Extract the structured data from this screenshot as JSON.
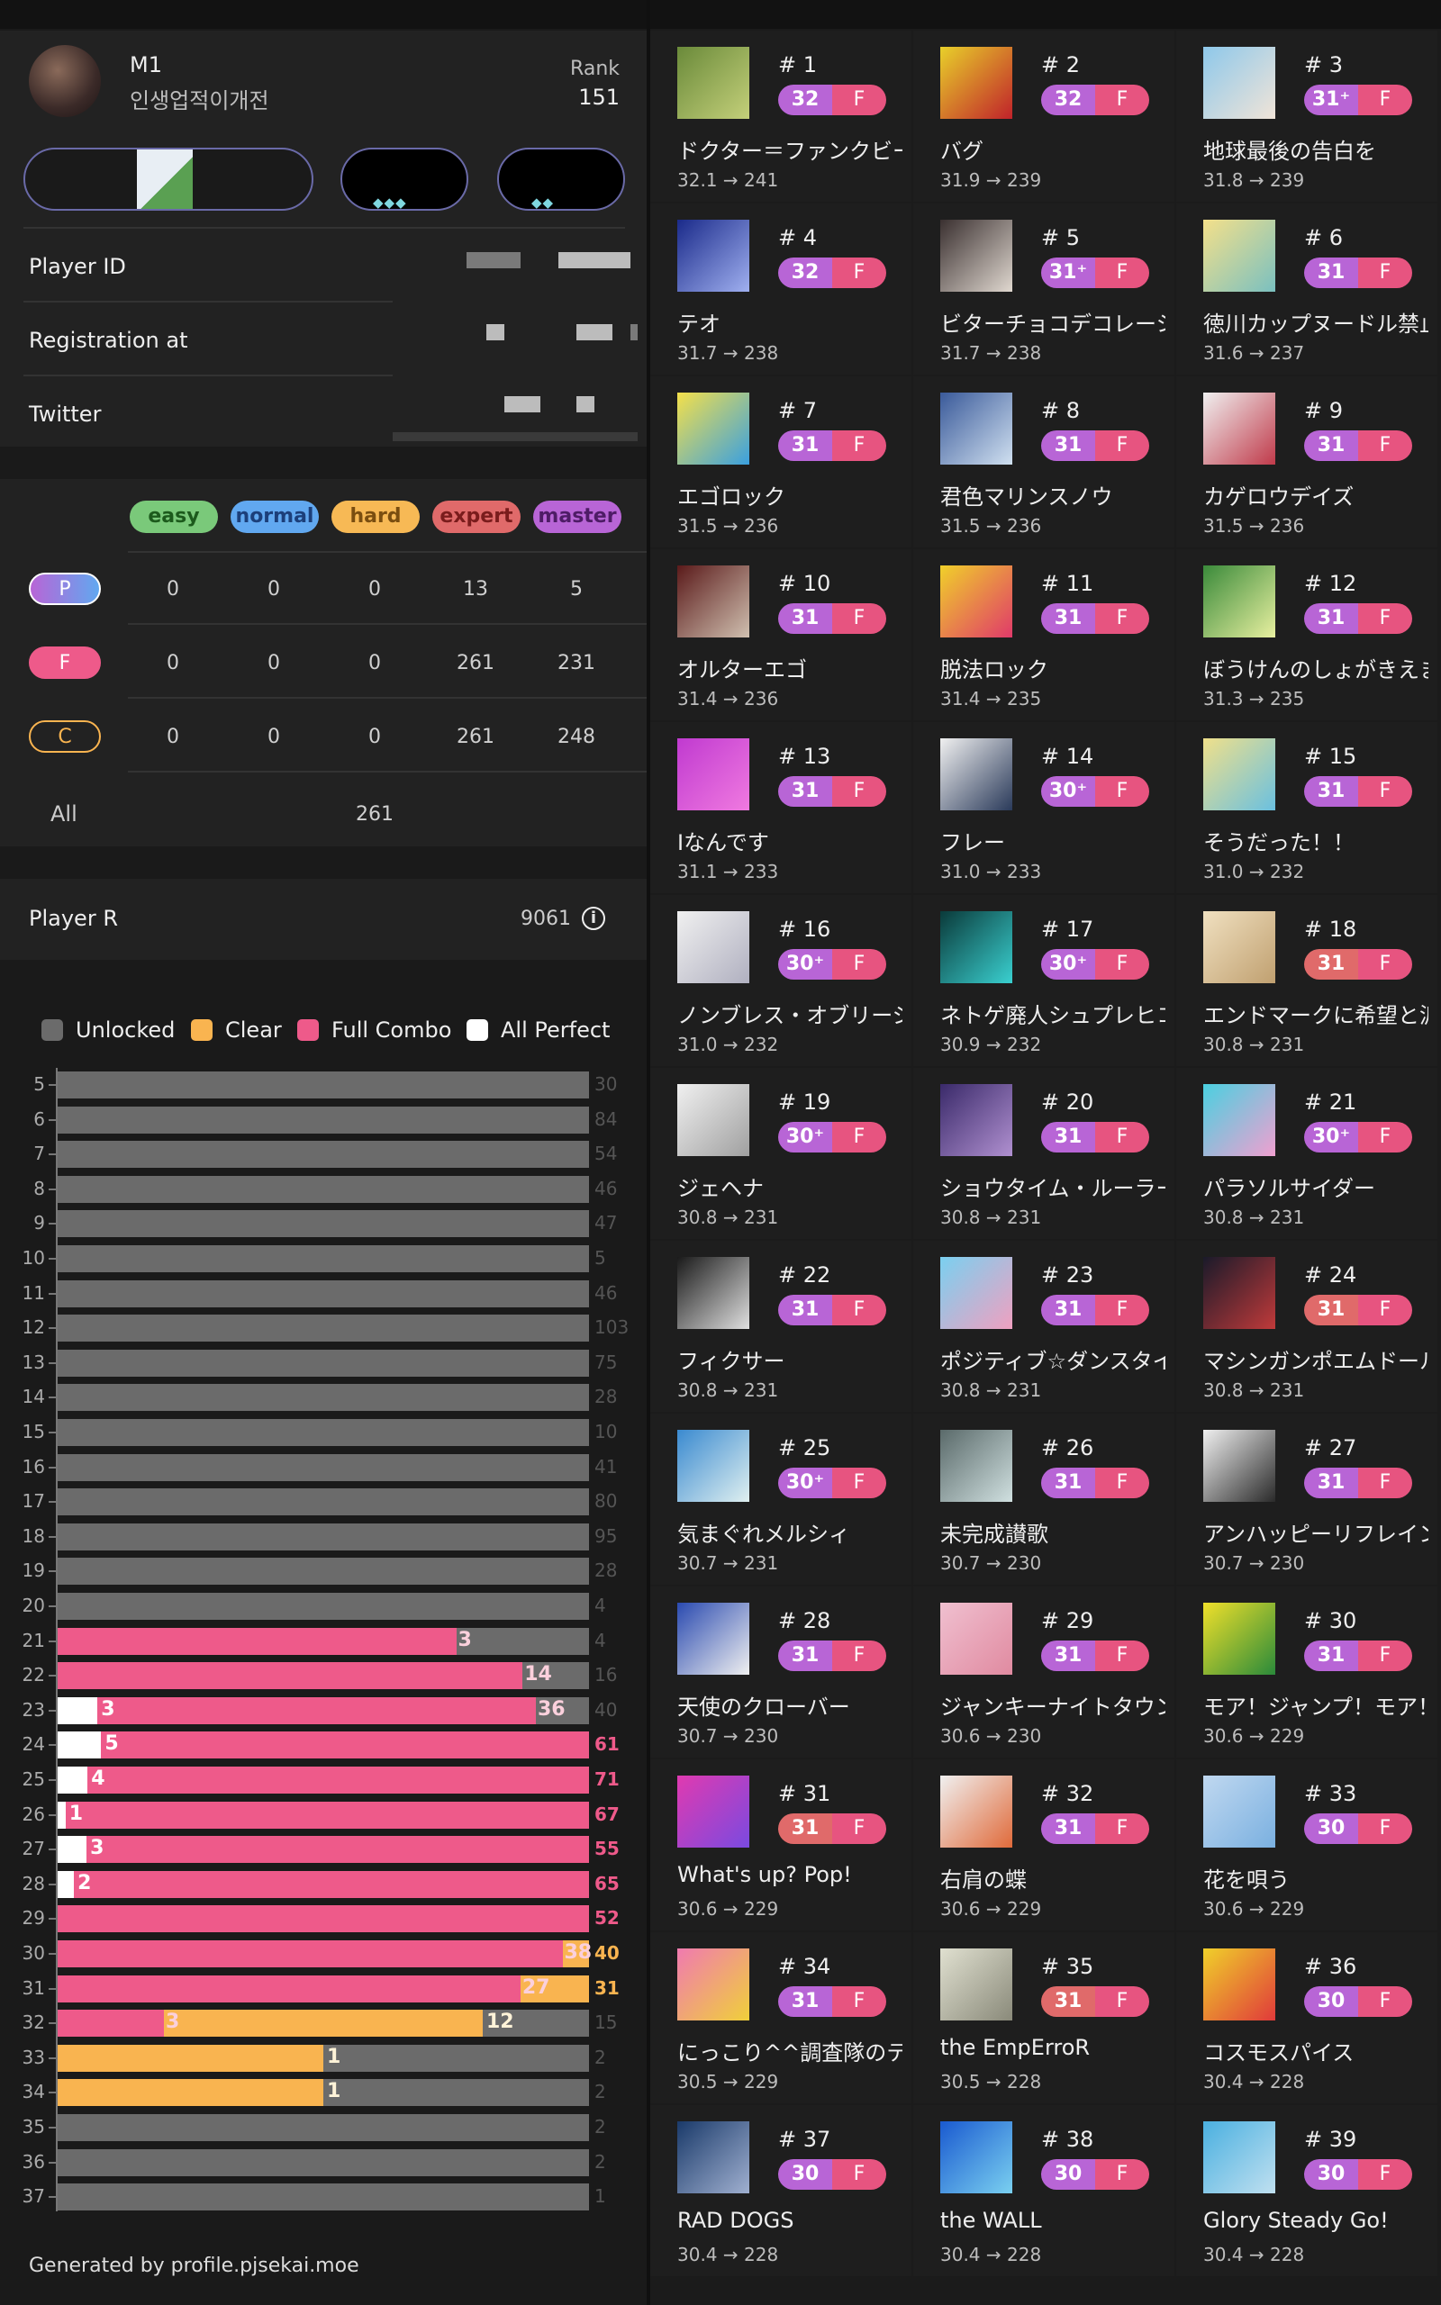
{
  "profile": {
    "name": "M1",
    "word": "인생업적이개전",
    "rank_label": "Rank",
    "rank": "151"
  },
  "info": {
    "player_id_label": "Player ID",
    "registration_label": "Registration at",
    "twitter_label": "Twitter"
  },
  "difficulties": [
    {
      "label": "easy",
      "color": "#7ac97a",
      "text": "#1c5a1c"
    },
    {
      "label": "normal",
      "color": "#61a8f0",
      "text": "#1c3f7a"
    },
    {
      "label": "hard",
      "color": "#f7b955",
      "text": "#7a4e10"
    },
    {
      "label": "expert",
      "color": "#e06a6a",
      "text": "#7a1c1c"
    },
    {
      "label": "master",
      "color": "#b865d6",
      "text": "#4e1c66"
    }
  ],
  "clear_table": {
    "rows": [
      {
        "badge": "P",
        "values": [
          "0",
          "0",
          "0",
          "13",
          "5"
        ]
      },
      {
        "badge": "F",
        "values": [
          "0",
          "0",
          "0",
          "261",
          "231"
        ]
      },
      {
        "badge": "C",
        "values": [
          "0",
          "0",
          "0",
          "261",
          "248"
        ]
      }
    ],
    "all_label": "All",
    "all_value": "261"
  },
  "player_r": {
    "label": "Player R",
    "value": "9061",
    "info_icon": "info-icon"
  },
  "legend": [
    "Unlocked",
    "Clear",
    "Full Combo",
    "All Perfect"
  ],
  "legend_colors": {
    "unlocked": "#6b6b6b",
    "clear": "#f9b450",
    "fullcombo": "#ee5a8a",
    "allperfect": "#ffffff"
  },
  "chart_data": {
    "type": "bar",
    "orientation": "horizontal-stacked",
    "levels": [
      5,
      6,
      7,
      8,
      9,
      10,
      11,
      12,
      13,
      14,
      15,
      16,
      17,
      18,
      19,
      20,
      21,
      22,
      23,
      24,
      25,
      26,
      27,
      28,
      29,
      30,
      31,
      32,
      33,
      34,
      35,
      36,
      37
    ],
    "totals": [
      30,
      84,
      54,
      46,
      47,
      5,
      46,
      103,
      75,
      28,
      10,
      41,
      80,
      95,
      28,
      4,
      4,
      16,
      40,
      61,
      71,
      67,
      55,
      65,
      52,
      40,
      31,
      15,
      2,
      2,
      2,
      2,
      1
    ],
    "series": [
      {
        "name": "All Perfect",
        "values": [
          0,
          0,
          0,
          0,
          0,
          0,
          0,
          0,
          0,
          0,
          0,
          0,
          0,
          0,
          0,
          0,
          0,
          0,
          3,
          5,
          4,
          1,
          3,
          2,
          0,
          0,
          0,
          0,
          0,
          0,
          0,
          0,
          0
        ]
      },
      {
        "name": "Full Combo",
        "values": [
          0,
          0,
          0,
          0,
          0,
          0,
          0,
          0,
          0,
          0,
          0,
          0,
          0,
          0,
          0,
          0,
          3,
          14,
          36,
          61,
          71,
          67,
          55,
          65,
          52,
          38,
          27,
          3,
          0,
          0,
          0,
          0,
          0
        ]
      },
      {
        "name": "Clear",
        "values": [
          0,
          0,
          0,
          0,
          0,
          0,
          0,
          0,
          0,
          0,
          0,
          0,
          0,
          0,
          0,
          0,
          3,
          14,
          36,
          61,
          71,
          67,
          55,
          65,
          52,
          40,
          31,
          12,
          1,
          1,
          0,
          0,
          0
        ]
      }
    ]
  },
  "footer": "Generated by profile.pjsekai.moe",
  "songs": [
    {
      "rank": "# 1",
      "lvl": "32",
      "title": "ドクター＝ファンクビート",
      "score": "32.1 → 241",
      "color": "#b865d6",
      "img": [
        "#6a8a3a",
        "#c4d07a"
      ]
    },
    {
      "rank": "# 2",
      "lvl": "32",
      "title": "バグ",
      "score": "31.9 → 239",
      "color": "#b865d6",
      "img": [
        "#e8d02a",
        "#c0222a"
      ]
    },
    {
      "rank": "# 3",
      "lvl": "31⁺",
      "title": "地球最後の告白を",
      "score": "31.8 → 239",
      "color": "#b865d6",
      "img": [
        "#8ec8ea",
        "#f0e4d8"
      ]
    },
    {
      "rank": "# 4",
      "lvl": "32",
      "title": "テオ",
      "score": "31.7 → 238",
      "color": "#b865d6",
      "img": [
        "#1a2a8a",
        "#a0b0f0"
      ]
    },
    {
      "rank": "# 5",
      "lvl": "31⁺",
      "title": "ビターチョコデコレーション",
      "score": "31.7 → 238",
      "color": "#b865d6",
      "img": [
        "#3a3030",
        "#e0d8d0"
      ]
    },
    {
      "rank": "# 6",
      "lvl": "31",
      "title": "徳川カップヌードル禁止令",
      "score": "31.6 → 237",
      "color": "#b865d6",
      "img": [
        "#f4e08a",
        "#7ac0c0"
      ]
    },
    {
      "rank": "# 7",
      "lvl": "31",
      "title": "エゴロック",
      "score": "31.5 → 236",
      "color": "#b865d6",
      "img": [
        "#f4e04a",
        "#3aa0e0"
      ]
    },
    {
      "rank": "# 8",
      "lvl": "31",
      "title": "君色マリンスノウ",
      "score": "31.5 → 236",
      "color": "#b865d6",
      "img": [
        "#3a5a9a",
        "#d0e0f0"
      ]
    },
    {
      "rank": "# 9",
      "lvl": "31",
      "title": "カゲロウデイズ",
      "score": "31.5 → 236",
      "color": "#b865d6",
      "img": [
        "#f0f0f0",
        "#c03a4a"
      ]
    },
    {
      "rank": "# 10",
      "lvl": "31",
      "title": "オルターエゴ",
      "score": "31.4 → 236",
      "color": "#b865d6",
      "img": [
        "#5a1a1a",
        "#d0c0b0"
      ]
    },
    {
      "rank": "# 11",
      "lvl": "31",
      "title": "脱法ロック",
      "score": "31.4 → 235",
      "color": "#b865d6",
      "img": [
        "#f0d02a",
        "#e03a6a"
      ]
    },
    {
      "rank": "# 12",
      "lvl": "31",
      "title": "ぼうけんのしょがきえました！",
      "score": "31.3 → 235",
      "color": "#b865d6",
      "img": [
        "#3a8a3a",
        "#e8f0a0"
      ]
    },
    {
      "rank": "# 13",
      "lvl": "31",
      "title": "Iなんです",
      "score": "31.1 → 233",
      "color": "#b865d6",
      "img": [
        "#c03ad0",
        "#f07ae0"
      ]
    },
    {
      "rank": "# 14",
      "lvl": "30⁺",
      "title": "フレー",
      "score": "31.0 → 233",
      "color": "#b865d6",
      "img": [
        "#f0f0f0",
        "#2a3a5a"
      ]
    },
    {
      "rank": "# 15",
      "lvl": "31",
      "title": "そうだった！！",
      "score": "31.0 → 232",
      "color": "#b865d6",
      "img": [
        "#f0e08a",
        "#6ac0e0"
      ]
    },
    {
      "rank": "# 16",
      "lvl": "30⁺",
      "title": "ノンブレス・オブリージュ",
      "score": "31.0 → 232",
      "color": "#b865d6",
      "img": [
        "#f0f0f0",
        "#b0b0c0"
      ]
    },
    {
      "rank": "# 17",
      "lvl": "30⁺",
      "title": "ネトゲ廃人シュプレヒコール",
      "score": "30.9 → 232",
      "color": "#b865d6",
      "img": [
        "#0a3a3a",
        "#3ad0d0"
      ]
    },
    {
      "rank": "# 18",
      "lvl": "31",
      "title": "エンドマークに希望と涙を添えて",
      "score": "30.8 → 231",
      "color": "#e06a6a",
      "img": [
        "#f0e0c0",
        "#c0a070"
      ]
    },
    {
      "rank": "# 19",
      "lvl": "30⁺",
      "title": "ジェヘナ",
      "score": "30.8 → 231",
      "color": "#b865d6",
      "img": [
        "#f0f0f0",
        "#a0a0a0"
      ]
    },
    {
      "rank": "# 20",
      "lvl": "31",
      "title": "ショウタイム・ルーラー",
      "score": "30.8 → 231",
      "color": "#b865d6",
      "img": [
        "#3a2a6a",
        "#b090d0"
      ]
    },
    {
      "rank": "# 21",
      "lvl": "30⁺",
      "title": "パラソルサイダー",
      "score": "30.8 → 231",
      "color": "#b865d6",
      "img": [
        "#4ad0e0",
        "#f0a0d0"
      ]
    },
    {
      "rank": "# 22",
      "lvl": "31",
      "title": "フィクサー",
      "score": "30.8 → 231",
      "color": "#b865d6",
      "img": [
        "#1a1a1a",
        "#e0e0e0"
      ]
    },
    {
      "rank": "# 23",
      "lvl": "31",
      "title": "ポジティブ☆ダンスタイム",
      "score": "30.8 → 231",
      "color": "#b865d6",
      "img": [
        "#7ad0f0",
        "#f0a0c0"
      ]
    },
    {
      "rank": "# 24",
      "lvl": "31",
      "title": "マシンガンポエムドール",
      "score": "30.8 → 231",
      "color": "#e06a6a",
      "img": [
        "#1a1a2a",
        "#c03a3a"
      ]
    },
    {
      "rank": "# 25",
      "lvl": "30⁺",
      "title": "気まぐれメルシィ",
      "score": "30.7 → 231",
      "color": "#b865d6",
      "img": [
        "#3a8ad0",
        "#e0f0f0"
      ]
    },
    {
      "rank": "# 26",
      "lvl": "31",
      "title": "未完成讃歌",
      "score": "30.7 → 230",
      "color": "#b865d6",
      "img": [
        "#5a6a6a",
        "#d0e0e0"
      ]
    },
    {
      "rank": "# 27",
      "lvl": "31",
      "title": "アンハッピーリフレイン",
      "score": "30.7 → 230",
      "color": "#b865d6",
      "img": [
        "#f0f0f0",
        "#2a2a2a"
      ]
    },
    {
      "rank": "# 28",
      "lvl": "31",
      "title": "天使のクローバー",
      "score": "30.7 → 230",
      "color": "#b865d6",
      "img": [
        "#2a4ab0",
        "#f0f0f0"
      ]
    },
    {
      "rank": "# 29",
      "lvl": "31",
      "title": "ジャンキーナイトタウンオーケストラ",
      "score": "30.6 → 230",
      "color": "#b865d6",
      "img": [
        "#f0c0d0",
        "#e08aa0"
      ]
    },
    {
      "rank": "# 30",
      "lvl": "31",
      "title": "モア！ジャンプ！モア！",
      "score": "30.6 → 229",
      "color": "#b865d6",
      "img": [
        "#f0e02a",
        "#2a8a3a"
      ]
    },
    {
      "rank": "# 31",
      "lvl": "31",
      "title": "What's up? Pop!",
      "score": "30.6 → 229",
      "color": "#e06a6a",
      "img": [
        "#e03ab0",
        "#7a4ae0"
      ]
    },
    {
      "rank": "# 32",
      "lvl": "31",
      "title": "右肩の蝶",
      "score": "30.6 → 229",
      "color": "#b865d6",
      "img": [
        "#f0f0f0",
        "#e06a3a"
      ]
    },
    {
      "rank": "# 33",
      "lvl": "30",
      "title": "花を唄う",
      "score": "30.6 → 229",
      "color": "#b865d6",
      "img": [
        "#c0d8f0",
        "#7ab0e0"
      ]
    },
    {
      "rank": "# 34",
      "lvl": "31",
      "title": "にっこり^^調査隊のテーマ",
      "score": "30.5 → 229",
      "color": "#b865d6",
      "img": [
        "#f07ab0",
        "#f0d03a"
      ]
    },
    {
      "rank": "# 35",
      "lvl": "31",
      "title": "the EmpErroR",
      "score": "30.5 → 228",
      "color": "#e06a6a",
      "img": [
        "#e0e0d0",
        "#8a8a7a"
      ]
    },
    {
      "rank": "# 36",
      "lvl": "30",
      "title": "コスモスパイス",
      "score": "30.4 → 228",
      "color": "#b865d6",
      "img": [
        "#f0d02a",
        "#e03a3a"
      ]
    },
    {
      "rank": "# 37",
      "lvl": "30",
      "title": "RAD DOGS",
      "score": "30.4 → 228",
      "color": "#b865d6",
      "img": [
        "#1a3a6a",
        "#a0b0d0"
      ]
    },
    {
      "rank": "# 38",
      "lvl": "30",
      "title": "the WALL",
      "score": "30.4 → 228",
      "color": "#b865d6",
      "img": [
        "#1a5ad0",
        "#7ad0f0"
      ]
    },
    {
      "rank": "# 39",
      "lvl": "30",
      "title": "Glory Steady Go!",
      "score": "30.4 → 228",
      "color": "#b865d6",
      "img": [
        "#4ab0e0",
        "#c0e0f0"
      ]
    }
  ],
  "fc_badge_label": "F"
}
